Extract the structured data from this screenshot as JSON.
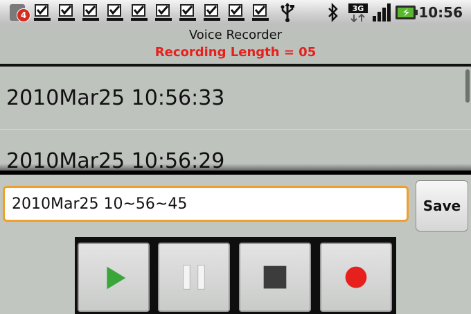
{
  "status_bar": {
    "notification_count": "4",
    "time": "10:56",
    "network_label": "3G",
    "icons": [
      "notification-app-icon",
      "download-complete-icon",
      "usb-icon",
      "bluetooth-icon",
      "3g-icon",
      "signal-icon",
      "battery-icon"
    ]
  },
  "app": {
    "title": "Voice Recorder",
    "recording_length": "Recording Length = 05"
  },
  "recordings": [
    {
      "label": "2010Mar25 10:56:33"
    },
    {
      "label": "2010Mar25 10:56:29"
    }
  ],
  "editor": {
    "filename_value": "2010Mar25 10~56~45",
    "save_label": "Save"
  },
  "controls": [
    "play-button",
    "pause-button",
    "stop-button",
    "record-button"
  ],
  "colors": {
    "accent_red": "#e4211c",
    "focus_orange": "#f0a02a",
    "play_green": "#3aa63a",
    "record_red": "#e5201d"
  }
}
